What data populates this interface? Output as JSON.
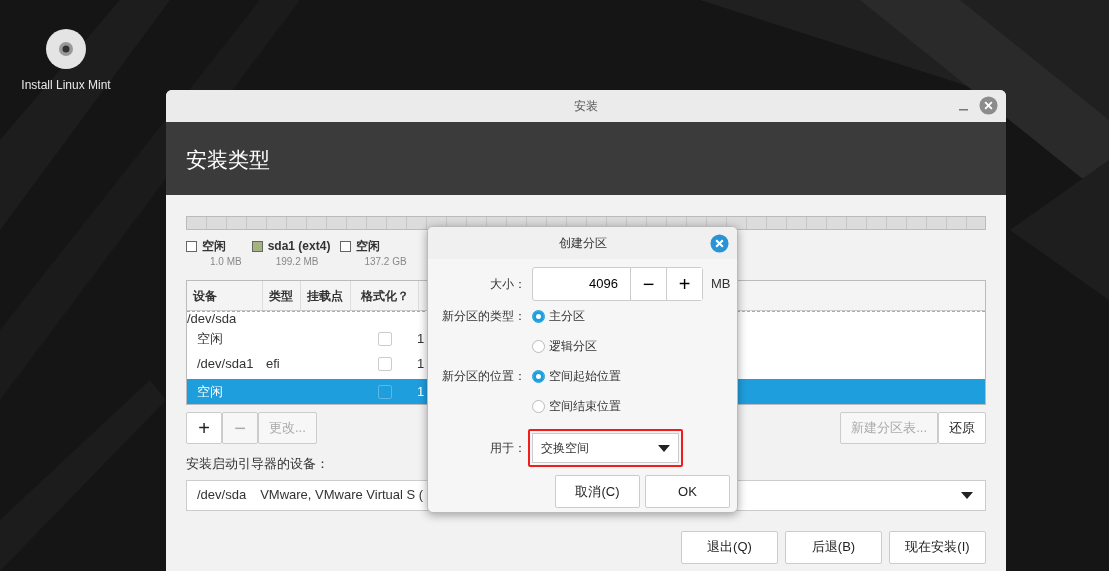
{
  "desktop_icons": [
    {
      "label": "Install Linux Mint"
    }
  ],
  "window": {
    "title": "安装",
    "heading": "安装类型"
  },
  "partition_legend": [
    {
      "name": "空闲",
      "size": "1.0 MB",
      "color": "#ffffff"
    },
    {
      "name": "sda1 (ext4)",
      "size": "199.2 MB",
      "color": "#a3b47e"
    },
    {
      "name": "空闲",
      "size": "137.2 GB",
      "color": "#ffffff"
    }
  ],
  "table": {
    "columns": [
      "设备",
      "类型",
      "挂载点",
      "格式化？"
    ],
    "rows": [
      {
        "kind": "disk",
        "device": "/dev/sda",
        "selected": false
      },
      {
        "kind": "partition",
        "device": "空闲",
        "format": false,
        "size": "1",
        "selected": false
      },
      {
        "kind": "partition",
        "device": "/dev/sda1",
        "type": "efi",
        "format": false,
        "size": "1",
        "selected": false
      },
      {
        "kind": "partition",
        "device": "空闲",
        "format": false,
        "size": "1",
        "selected": true
      }
    ]
  },
  "partition_buttons": [
    {
      "label": "+",
      "disabled": false
    },
    {
      "label": "−",
      "disabled": true
    },
    {
      "label": "更改...",
      "disabled": true
    }
  ],
  "table_buttons": [
    {
      "label": "新建分区表...",
      "disabled": true
    },
    {
      "label": "还原",
      "disabled": false
    }
  ],
  "bootloader": {
    "label": "安装启动引导器的设备：",
    "device": "/dev/sda",
    "description": "VMware, VMware Virtual S ("
  },
  "footer_buttons": [
    "退出(Q)",
    "后退(B)",
    "现在安装(I)"
  ],
  "dialog": {
    "title": "创建分区",
    "size_label": "大小：",
    "size_value": "4096",
    "decrement": "−",
    "increment": "+",
    "unit": "MB",
    "type_label": "新分区的类型：",
    "type_options": [
      {
        "label": "主分区",
        "selected": true
      },
      {
        "label": "逻辑分区",
        "selected": false
      }
    ],
    "location_label": "新分区的位置：",
    "location_options": [
      {
        "label": "空间起始位置",
        "selected": true
      },
      {
        "label": "空间结束位置",
        "selected": false
      }
    ],
    "use_label": "用于：",
    "use_value": "交换空间",
    "use_highlighted": true,
    "buttons": [
      "取消(C)",
      "OK"
    ]
  }
}
